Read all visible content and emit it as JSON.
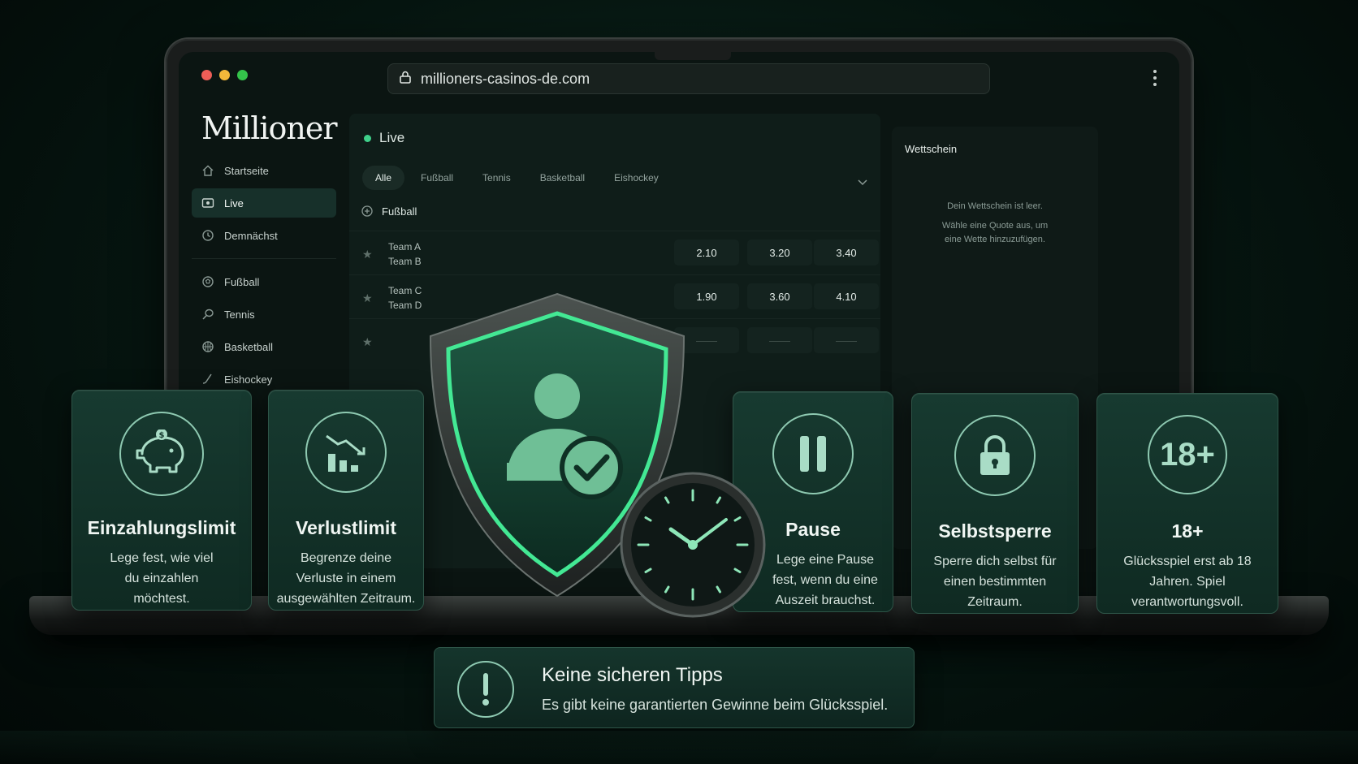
{
  "browser": {
    "url": "millioners-casinos-de.com"
  },
  "site": {
    "logo": "Millioner"
  },
  "sidebar": {
    "items": [
      {
        "label": "Startseite",
        "icon": "home-icon"
      },
      {
        "label": "Live",
        "icon": "live-icon",
        "active": true
      },
      {
        "label": "Demnächst",
        "icon": "clock-icon"
      },
      {
        "label": "Fußball",
        "icon": "soccer-ball-icon"
      },
      {
        "label": "Tennis",
        "icon": "tennis-icon"
      },
      {
        "label": "Basketball",
        "icon": "basketball-icon"
      },
      {
        "label": "Eishockey",
        "icon": "hockey-icon"
      }
    ]
  },
  "main": {
    "heading": "Live",
    "tabs": [
      "Alle",
      "Fußball",
      "Tennis",
      "Basketball",
      "Eishockey"
    ],
    "active_tab": "Alle",
    "section_title": "Fußball",
    "matches": [
      {
        "home": "Team A",
        "away": "Team B",
        "odds": [
          "2.10",
          "3.20",
          "3.40"
        ]
      },
      {
        "home": "Team C",
        "away": "Team D",
        "odds": [
          "1.90",
          "3.60",
          "4.10"
        ]
      }
    ]
  },
  "betslip": {
    "title": "Wettschein",
    "empty_line1": "Dein Wettschein ist leer.",
    "empty_line2": "Wähle eine Quote aus, um eine Wette hinzuzufügen."
  },
  "cards": [
    {
      "title": "Einzahlungslimit",
      "desc": "Lege fest, wie viel du einzahlen möchtest.",
      "icon": "piggy-bank-icon"
    },
    {
      "title": "Verlustlimit",
      "desc": "Begrenze deine Verluste in einem ausgewählten Zeitraum.",
      "icon": "declining-chart-icon"
    },
    {
      "title": "Pause",
      "desc": "Lege eine Pause fest, wenn du eine Auszeit brauchst.",
      "icon": "pause-icon"
    },
    {
      "title": "Selbstsperre",
      "desc": "Sperre dich selbst für einen bestimmten Zeitraum.",
      "icon": "padlock-icon"
    },
    {
      "title": "18+",
      "desc": "Glücksspiel erst ab 18 Jahren. Spiel verantwortungsvoll.",
      "icon": "age-18-icon",
      "badge": "18+"
    }
  ],
  "warning": {
    "title": "Keine sicheren Tipps",
    "desc": "Es gibt keine garantierten Gewinne beim Glücksspiel.",
    "icon": "exclamation-icon"
  },
  "colors": {
    "accent": "#3fd08a",
    "card_bg": "#173a30",
    "outline": "#8ec9b1"
  }
}
